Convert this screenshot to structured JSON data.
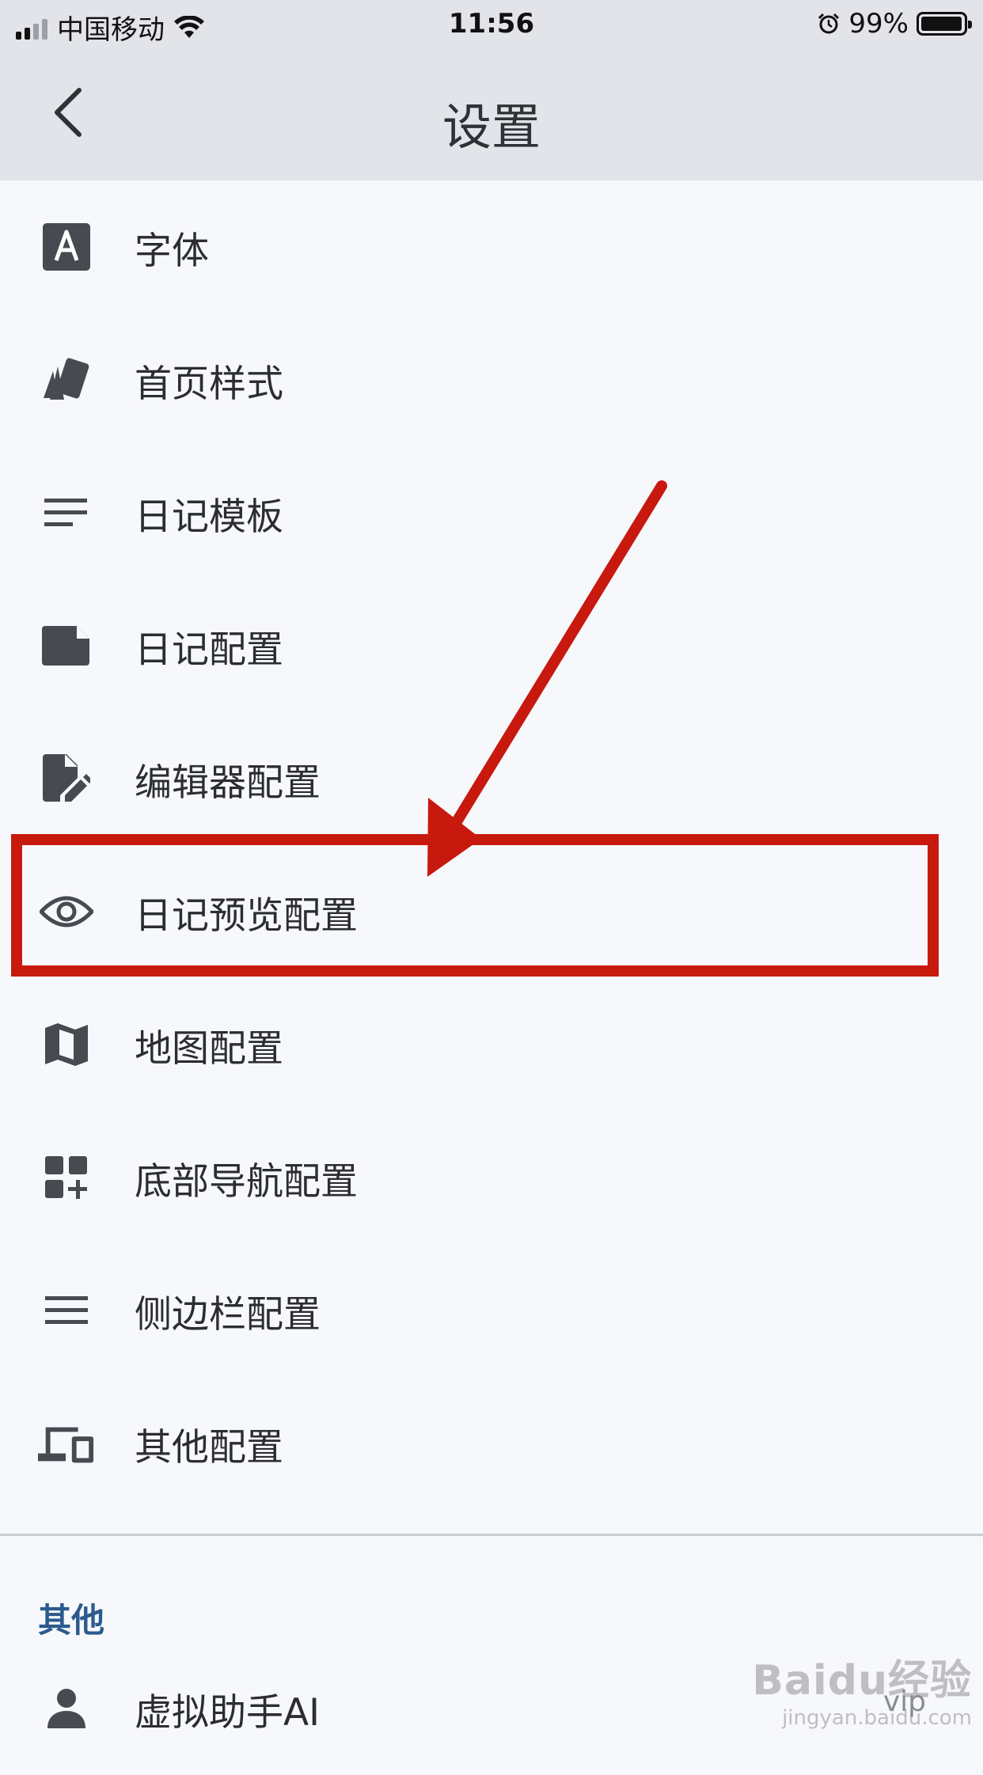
{
  "status_bar": {
    "carrier": "中国移动",
    "time": "11:56",
    "battery": "99%"
  },
  "header": {
    "title": "设置"
  },
  "settings": {
    "items": [
      {
        "label": "字体",
        "icon": "font-icon"
      },
      {
        "label": "首页样式",
        "icon": "style-icon"
      },
      {
        "label": "日记模板",
        "icon": "template-icon"
      },
      {
        "label": "日记配置",
        "icon": "note-icon"
      },
      {
        "label": "编辑器配置",
        "icon": "edit-document-icon"
      },
      {
        "label": "日记预览配置",
        "icon": "eye-icon"
      },
      {
        "label": "地图配置",
        "icon": "map-icon"
      },
      {
        "label": "底部导航配置",
        "icon": "add-widget-icon"
      },
      {
        "label": "侧边栏配置",
        "icon": "menu-icon"
      },
      {
        "label": "其他配置",
        "icon": "devices-icon"
      }
    ]
  },
  "other_section": {
    "title": "其他",
    "items": [
      {
        "label": "虚拟助手AI",
        "icon": "person-icon"
      }
    ]
  },
  "annotation": {
    "color": "#c8190f"
  },
  "watermark": {
    "logo": "Baidu经验",
    "url": "jingyan.baidu.com",
    "vip": "vip"
  }
}
